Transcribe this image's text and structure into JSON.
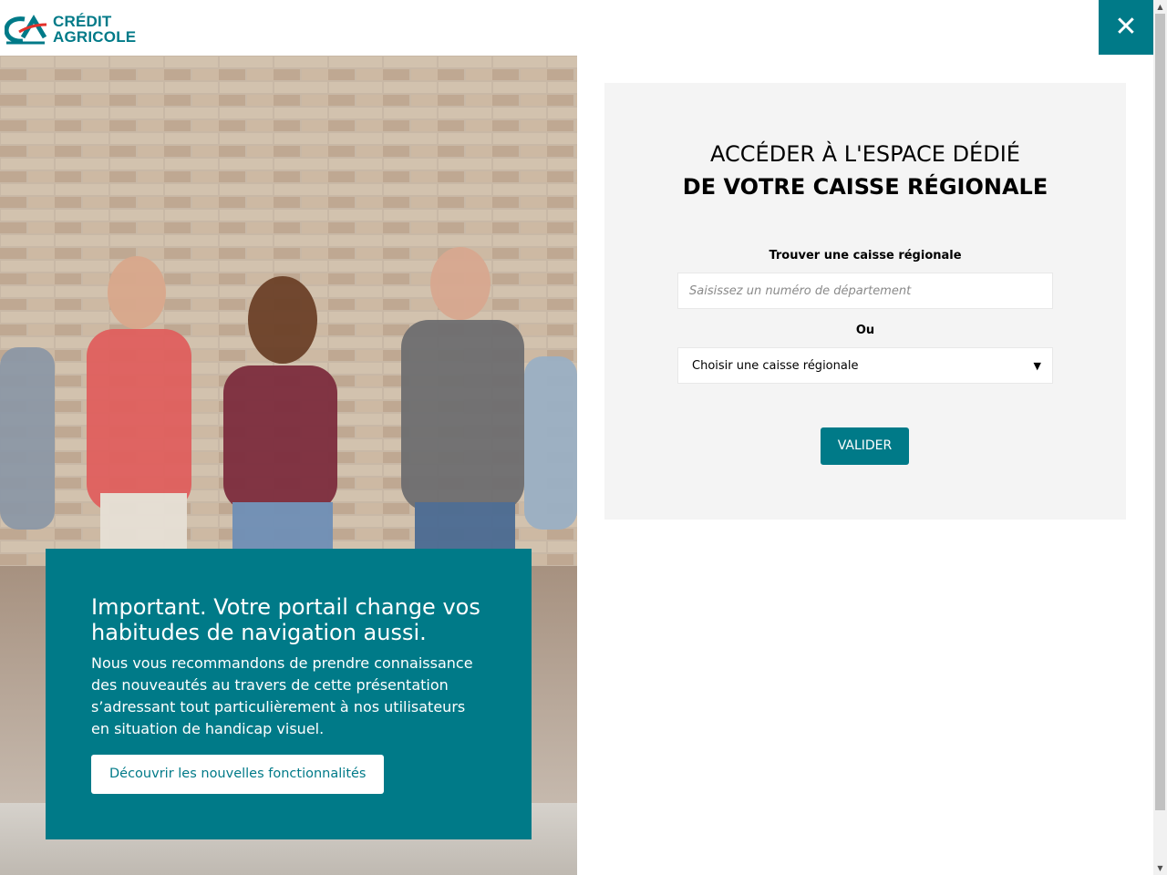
{
  "header": {
    "logo_line1": "CRÉDIT",
    "logo_line2": "AGRICOLE",
    "close_icon": "close-icon",
    "close_glyph": "✕"
  },
  "promo": {
    "title": "Important. Votre portail change vos habitudes de navigation aussi.",
    "text": "Nous vous recommandons de prendre connaissance des nouveautés au travers de cette présentation s’adressant tout particulièrement à nos utilisateurs en situation de handicap visuel.",
    "button_label": "Découvrir les nouvelles fonctionnalités"
  },
  "panel": {
    "title_line1": "ACCÉDER À L'ESPACE DÉDIÉ",
    "title_line2": "DE VOTRE CAISSE RÉGIONALE",
    "find_label": "Trouver une caisse régionale",
    "dept_placeholder": "Saisissez un numéro de département",
    "or_label": "Ou",
    "select_value": "Choisir une caisse régionale",
    "submit_label": "VALIDER"
  },
  "colors": {
    "brand": "#007a88",
    "panel_bg": "#f4f4f4"
  }
}
